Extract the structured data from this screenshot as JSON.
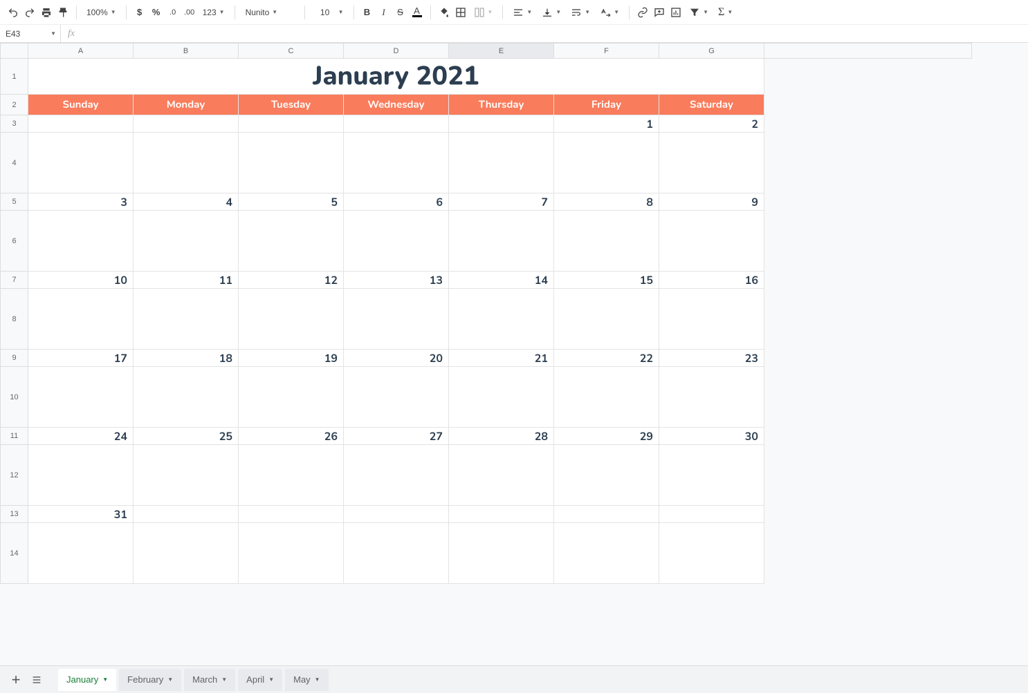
{
  "toolbar": {
    "zoom": "100%",
    "font": "Nunito",
    "fontSize": "10",
    "numberFormat": "123"
  },
  "nameBox": "E43",
  "formula": "",
  "columns": [
    "A",
    "B",
    "C",
    "D",
    "E",
    "F",
    "G"
  ],
  "selectedCol": "E",
  "rows": [
    "1",
    "2",
    "3",
    "4",
    "5",
    "6",
    "7",
    "8",
    "9",
    "10",
    "11",
    "12",
    "13",
    "14"
  ],
  "calendar": {
    "title": "January 2021",
    "daysOfWeek": [
      "Sunday",
      "Monday",
      "Tuesday",
      "Wednesday",
      "Thursday",
      "Friday",
      "Saturday"
    ],
    "weeks": [
      [
        "",
        "",
        "",
        "",
        "",
        "1",
        "2"
      ],
      [
        "3",
        "4",
        "5",
        "6",
        "7",
        "8",
        "9"
      ],
      [
        "10",
        "11",
        "12",
        "13",
        "14",
        "15",
        "16"
      ],
      [
        "17",
        "18",
        "19",
        "20",
        "21",
        "22",
        "23"
      ],
      [
        "24",
        "25",
        "26",
        "27",
        "28",
        "29",
        "30"
      ],
      [
        "31",
        "",
        "",
        "",
        "",
        "",
        ""
      ]
    ]
  },
  "sheetTabs": {
    "active": "January",
    "tabs": [
      "January",
      "February",
      "March",
      "April",
      "May"
    ]
  }
}
